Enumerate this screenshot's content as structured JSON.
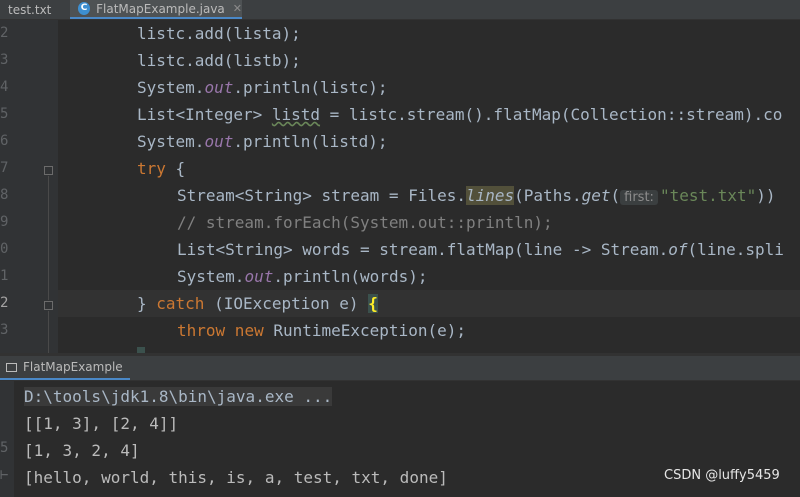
{
  "tabs": [
    {
      "label": "test.txt"
    },
    {
      "label": "FlatMapExample.java",
      "icon": "c-class-icon"
    }
  ],
  "gutter_numbers": [
    "2",
    "3",
    "4",
    "5",
    "6",
    "7",
    "8",
    "9",
    "0",
    "1",
    "2",
    "3"
  ],
  "code": {
    "l1": "listc.add(lista);",
    "l2": "listc.add(listb);",
    "l3a": "System.",
    "l3b": "out",
    "l3c": ".println(listc);",
    "l4a": "List<Integer> ",
    "l4b": "listd",
    "l4c": " = listc.stream().flatMap(Collection::stream).co",
    "l5a": "System.",
    "l5b": "out",
    "l5c": ".println(listd);",
    "l6a": "try",
    "l6b": " {",
    "l7a": "Stream<String> stream = Files.",
    "l7b": "lines",
    "l7c": "(Paths.",
    "l7d": "get",
    "l7e": "(",
    "l7hint": "first:",
    "l7str": "\"test.txt\"",
    "l7f": "))",
    "l8": "// stream.forEach(System.out::println);",
    "l9a": "List<String> words = stream.flatMap(line -> Stream.",
    "l9b": "of",
    "l9c": "(line.spli",
    "l10a": "System.",
    "l10b": "out",
    "l10c": ".println(words);",
    "l11a": "} ",
    "l11b": "catch",
    "l11c": " (IOException e) ",
    "l11d": "{",
    "l12a": "throw",
    "l12b": " new",
    "l12c": " RuntimeException(e);"
  },
  "run": {
    "tab_label": "FlatMapExample",
    "gutter": [
      "",
      "",
      "5",
      "⊢"
    ],
    "lines": [
      "D:\\tools\\jdk1.8\\bin\\java.exe ...",
      "[[1, 3], [2, 4]]",
      "[1, 3, 2, 4]",
      "[hello, world, this, is, a, test, txt, done]"
    ]
  },
  "watermark": "CSDN @luffy5459",
  "colors": {
    "keyword": "#cc7832",
    "field": "#9876aa",
    "string": "#6a8759",
    "comment": "#808080",
    "text": "#a9b7c6",
    "accent": "#4a88c7"
  }
}
